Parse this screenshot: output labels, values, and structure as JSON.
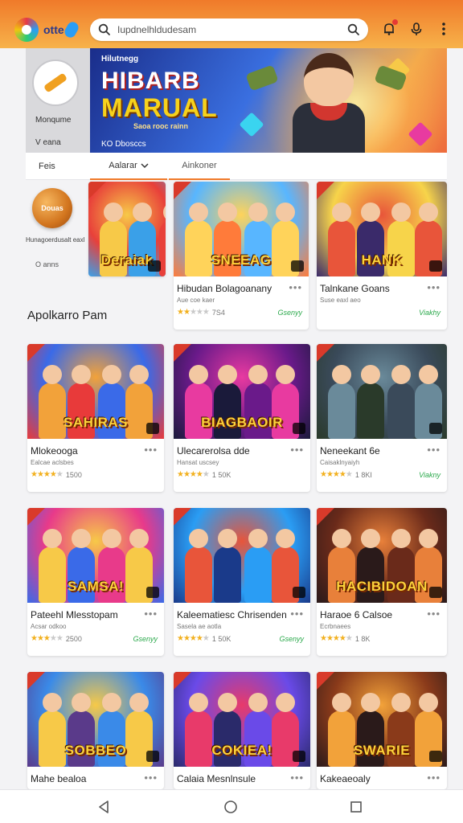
{
  "app": {
    "logo_text": "otte"
  },
  "search": {
    "value": "Iupdnelhldudesam"
  },
  "sidebar": {
    "label1": "Monqume",
    "label2": "V eana"
  },
  "banner": {
    "eyebrow": "Hilutnegg",
    "title_line1": "HIBARB",
    "title_line2": "MARUAL",
    "subtitle": "Saoa rooc rainn",
    "footer": "KO Dbosccs"
  },
  "tabs": [
    "Feis",
    "Aalarar",
    "Ainkoner"
  ],
  "left_promo": {
    "coin_text": "Douas",
    "label1": "Hunagoerdusalt eaxl",
    "label2": "O anns"
  },
  "featured": [
    {
      "thumb_title": "Deraiak",
      "name": "",
      "sub": "",
      "rating": "",
      "tag": "",
      "palette": [
        "#e8403a",
        "#f7c948",
        "#3aa0e8"
      ]
    },
    {
      "thumb_title": "SNEEAG",
      "name": "Hibudan Bolagoanany",
      "sub": "Aue coe kaer",
      "rating": "7S4",
      "stars": 2,
      "tag": "Gsenyy",
      "palette": [
        "#58b6ff",
        "#ffd35a",
        "#ff7b3a"
      ]
    },
    {
      "thumb_title": "HANK",
      "name": "Talnkane Goans",
      "sub": "Suse eaxl aeo",
      "rating": "",
      "stars": 0,
      "tag": "Viakhy",
      "palette": [
        "#f7d44a",
        "#e8553a",
        "#3a2a6a"
      ]
    }
  ],
  "section": {
    "title": "Apolkarro Pam"
  },
  "grid": [
    {
      "thumb_title": "SAHIRAS",
      "name": "Mlokeooga",
      "sub": "Ealcae aclsbes",
      "rating": "1500",
      "stars": 4,
      "tag": "",
      "palette": [
        "#3a6ae8",
        "#f2a23a",
        "#e83a3a"
      ]
    },
    {
      "thumb_title": "BIAGBAOIR",
      "name": "Ulecarerolsa dde",
      "sub": "Hansat uscsey",
      "rating": "1 50K",
      "stars": 4,
      "tag": "",
      "palette": [
        "#6a1a8a",
        "#e83aa0",
        "#1a1a3a"
      ]
    },
    {
      "thumb_title": "",
      "name": "Neneekant 6e",
      "sub": "Caisaklnyaiyh",
      "rating": "1 8KI",
      "stars": 4,
      "tag": "Viakny",
      "palette": [
        "#3a4a5a",
        "#6a8a9a",
        "#2a3a2a"
      ]
    },
    {
      "thumb_title": "SAMSA!",
      "name": "Pateehl Mlesstopam",
      "sub": "Acsar odkoo",
      "rating": "2500",
      "stars": 3,
      "tag": "Gsenyy",
      "palette": [
        "#e83a8a",
        "#f7c948",
        "#3a6ae8"
      ]
    },
    {
      "thumb_title": "",
      "name": "Kaleematiesc Chrisenden",
      "sub": "Sasela ae aotla",
      "rating": "1 50K",
      "stars": 4,
      "tag": "Gsenyy",
      "palette": [
        "#2a9df4",
        "#e8553a",
        "#1a3a8a"
      ]
    },
    {
      "thumb_title": "HACIBIDOAN",
      "name": "Haraoe 6 Calsoe",
      "sub": "Ecrbnaees",
      "rating": "1 8K",
      "stars": 4,
      "tag": "",
      "palette": [
        "#6a2a1a",
        "#e8803a",
        "#2a1a1a"
      ]
    },
    {
      "thumb_title": "SOBBEO",
      "name": "Mahe bealoa",
      "sub": "",
      "rating": "",
      "stars": 0,
      "tag": "",
      "palette": [
        "#3a8ae8",
        "#f7c948",
        "#5a3a8a"
      ]
    },
    {
      "thumb_title": "COKIEA!",
      "name": "Calaia Mesnlnsule",
      "sub": "",
      "rating": "",
      "stars": 0,
      "tag": "",
      "palette": [
        "#6a4ae8",
        "#e83a6a",
        "#2a2a6a"
      ]
    },
    {
      "thumb_title": "SWARIE",
      "name": "Kakeaeoaly",
      "sub": "",
      "rating": "",
      "stars": 0,
      "tag": "",
      "palette": [
        "#8a3a1a",
        "#f2a23a",
        "#2a1a1a"
      ]
    }
  ],
  "colors": {
    "accent": "#f07a2a",
    "accent_light": "#f7b24a",
    "rating_star": "#f2b01e",
    "tag_green": "#29a84a"
  },
  "icons": [
    "search-icon",
    "bell-icon",
    "mic-icon",
    "more-vert-icon",
    "back-icon",
    "home-icon",
    "recents-icon"
  ]
}
